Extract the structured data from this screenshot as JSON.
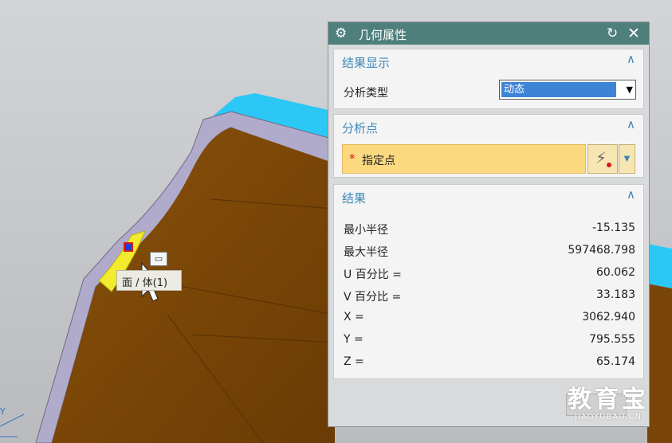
{
  "dialog": {
    "title": "几何属性",
    "icons": {
      "settings": "gear-icon",
      "reset": "reset-icon",
      "close": "close-icon"
    },
    "sections": {
      "result_display": {
        "heading": "结果显示",
        "analysis_type_label": "分析类型",
        "analysis_type_value": "动态"
      },
      "analysis_point": {
        "heading": "分析点",
        "required_marker": "*",
        "specify_point_label": "指定点"
      },
      "results": {
        "heading": "结果",
        "rows": [
          {
            "label": "最小半径",
            "value": "-15.135"
          },
          {
            "label": "最大半径",
            "value": "597468.798"
          },
          {
            "label": "U 百分比 =",
            "value": "60.062"
          },
          {
            "label": "V 百分比 =",
            "value": "33.183"
          },
          {
            "label": "X =",
            "value": "3062.940"
          },
          {
            "label": "Y =",
            "value": "795.555"
          },
          {
            "label": "Z =",
            "value": "65.174"
          }
        ]
      }
    }
  },
  "viewport": {
    "tooltip_text": "面 / 体(1)",
    "axis_label": "Y"
  },
  "watermark": {
    "main": "教育宝",
    "sub": "JIAOYUBAO.CN"
  },
  "colors": {
    "titlebar": "#4e7f7b",
    "section_heading": "#3f88b8",
    "selection_highlight": "#3d84d6",
    "required_row": "#fcd97f",
    "part_face": "#7a4508",
    "part_edge_cyan": "#2bc8f5"
  }
}
